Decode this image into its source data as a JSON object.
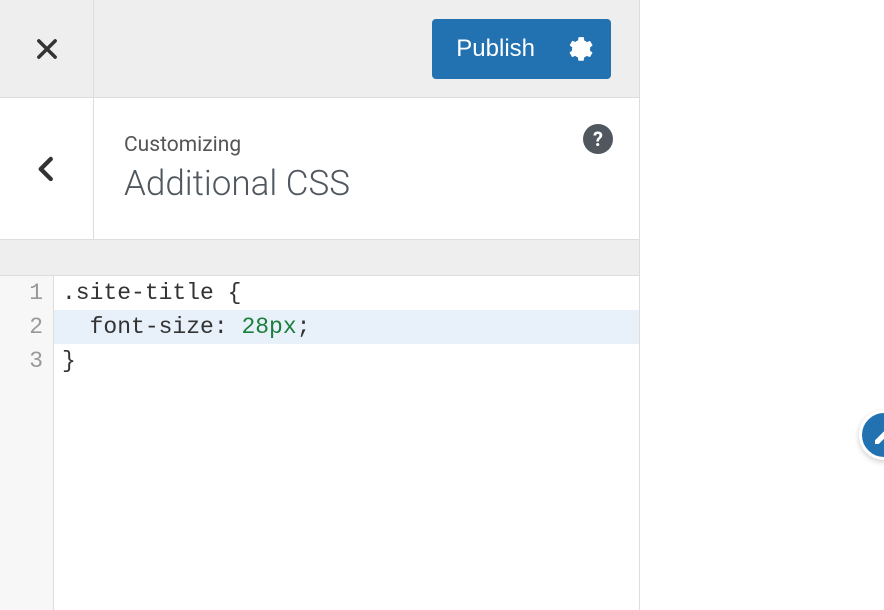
{
  "topbar": {
    "publish_label": "Publish",
    "close_icon": "close-icon",
    "gear_icon": "gear-icon"
  },
  "section": {
    "breadcrumb": "Customizing",
    "title": "Additional CSS",
    "help_icon": "?",
    "back_icon": "chevron-left-icon"
  },
  "editor": {
    "lines": [
      {
        "n": "1",
        "selector": ".site-title",
        "brace": " {"
      },
      {
        "n": "2",
        "indent": "  ",
        "property": "font-size",
        "colon": ": ",
        "value": "28px",
        "semi": ";",
        "active": true
      },
      {
        "n": "3",
        "brace_close": "}"
      }
    ]
  },
  "floating": {
    "edit_icon": "pencil-icon"
  }
}
